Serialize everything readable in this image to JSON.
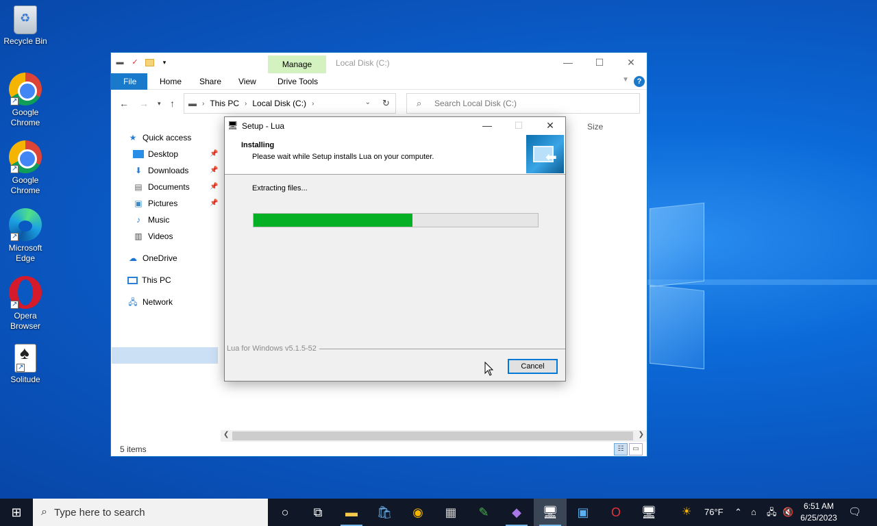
{
  "desktop": {
    "icons": [
      {
        "label": "Recycle Bin",
        "icon": "recycle-bin-icon"
      },
      {
        "label": "Google Chrome",
        "icon": "chrome-icon"
      },
      {
        "label": "Google Chrome",
        "icon": "chrome-icon"
      },
      {
        "label": "Microsoft Edge",
        "icon": "edge-icon"
      },
      {
        "label": "Opera Browser",
        "icon": "opera-icon"
      },
      {
        "label": "Solitude",
        "icon": "solitaire-icon"
      }
    ]
  },
  "explorer": {
    "title": "Local Disk (C:)",
    "contextual_tab": "Manage",
    "ribbon_tabs": [
      "File",
      "Home",
      "Share",
      "View",
      "Drive Tools"
    ],
    "address": {
      "crumbs": [
        "This PC",
        "Local Disk (C:)"
      ]
    },
    "search_placeholder": "Search Local Disk (C:)",
    "nav": {
      "quick_access": "Quick access",
      "items": [
        "Desktop",
        "Downloads",
        "Documents",
        "Pictures",
        "Music",
        "Videos"
      ],
      "onedrive": "OneDrive",
      "this_pc": "This PC",
      "network": "Network"
    },
    "column_size": "Size",
    "status": "5 items",
    "accent": "#1979ca"
  },
  "setup": {
    "title": "Setup - Lua",
    "heading": "Installing",
    "subheading": "Please wait while Setup installs Lua on your computer.",
    "status": "Extracting files...",
    "progress": 0.56,
    "progress_color": "#06b025",
    "version": "Lua for Windows v5.1.5-52",
    "cancel_label": "Cancel"
  },
  "taskbar": {
    "search_placeholder": "Type here to search",
    "weather": "76°F",
    "time": "6:51 AM",
    "date": "6/25/2023"
  }
}
